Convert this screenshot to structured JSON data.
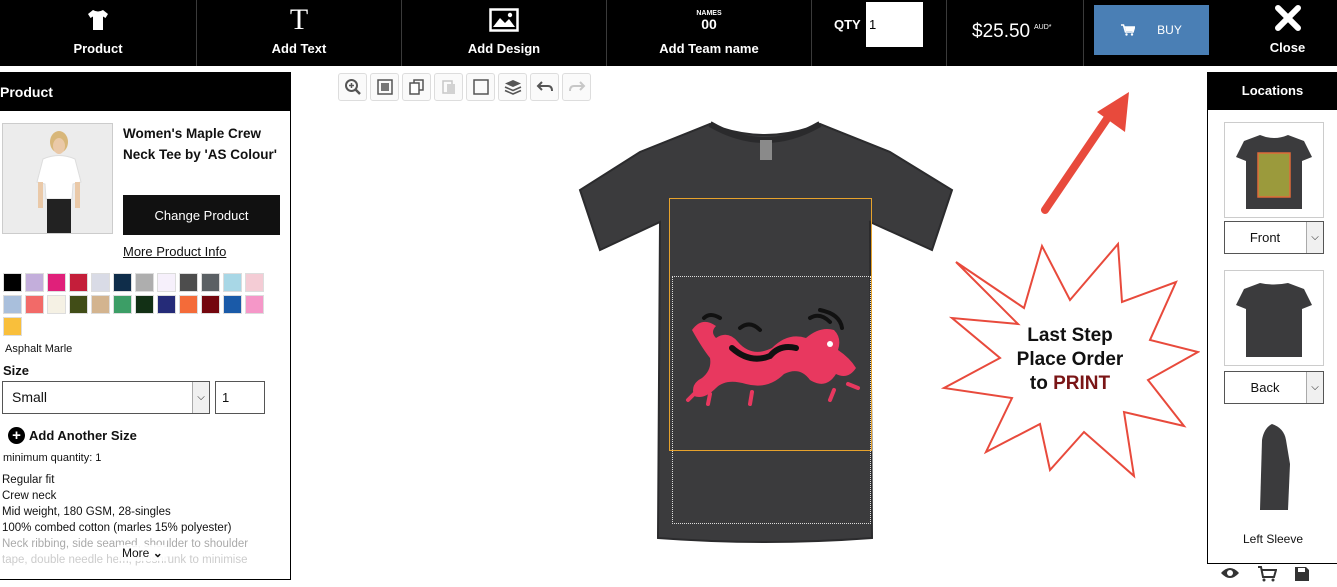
{
  "topbar": {
    "product_label": "Product",
    "add_text_label": "Add Text",
    "add_text_icon": "T",
    "add_design_label": "Add Design",
    "add_team_label": "Add Team name",
    "team_icon_top": "NAMES",
    "team_icon_num": "00",
    "qty_label": "QTY",
    "qty_value": "1",
    "price": "$25.50",
    "price_suffix": "AUD*",
    "buy_label": "BUY",
    "close_label": "Close",
    "buy_color": "#4a7fb5"
  },
  "left_panel": {
    "header": "Product",
    "product_name": "Women's Maple Crew Neck Tee by 'AS Colour'",
    "change_product_label": "Change Product",
    "more_info_label": "More Product Info",
    "swatches": [
      "#000000",
      "#c3aedb",
      "#e0207a",
      "#c41e3a",
      "#d9dbe6",
      "#0f2d4a",
      "#aeaeae",
      "#f6f0fb",
      "#4d4d4d",
      "#5b6064",
      "#a8d7e6",
      "#f4ccd5",
      "#a9bfdc",
      "#f26a68",
      "#f5f1e4",
      "#414d17",
      "#d3b48f",
      "#3c9e66",
      "#123015",
      "#252b78",
      "#f46b39",
      "#74060e",
      "#1a5aa8",
      "#f597c8",
      "#f9bf3b"
    ],
    "selected_color_name": "Asphalt Marle",
    "size_label": "Size",
    "size_value": "Small",
    "size_qty": "1",
    "add_size_label": "Add Another Size",
    "min_qty": "minimum quantity: 1",
    "features": [
      "Regular fit",
      "Crew neck",
      "Mid weight, 180 GSM, 28-singles",
      "100% combed cotton (marles 15% polyester)",
      "Neck ribbing, side seamed, shoulder to shoulder",
      "tape, double needle hem, preshrunk to minimise"
    ],
    "more_label": "More"
  },
  "toolbar": {
    "tools": [
      "zoom-in",
      "fit",
      "duplicate",
      "paste",
      "select",
      "layers",
      "undo",
      "redo"
    ]
  },
  "callout": {
    "line1": "Last Step",
    "line2": "Place Order",
    "line3_prefix": "to ",
    "line3_emph": "PRINT"
  },
  "right_panel": {
    "header": "Locations",
    "front_label": "Front",
    "back_label": "Back",
    "sleeve_label": "Left Sleeve"
  }
}
